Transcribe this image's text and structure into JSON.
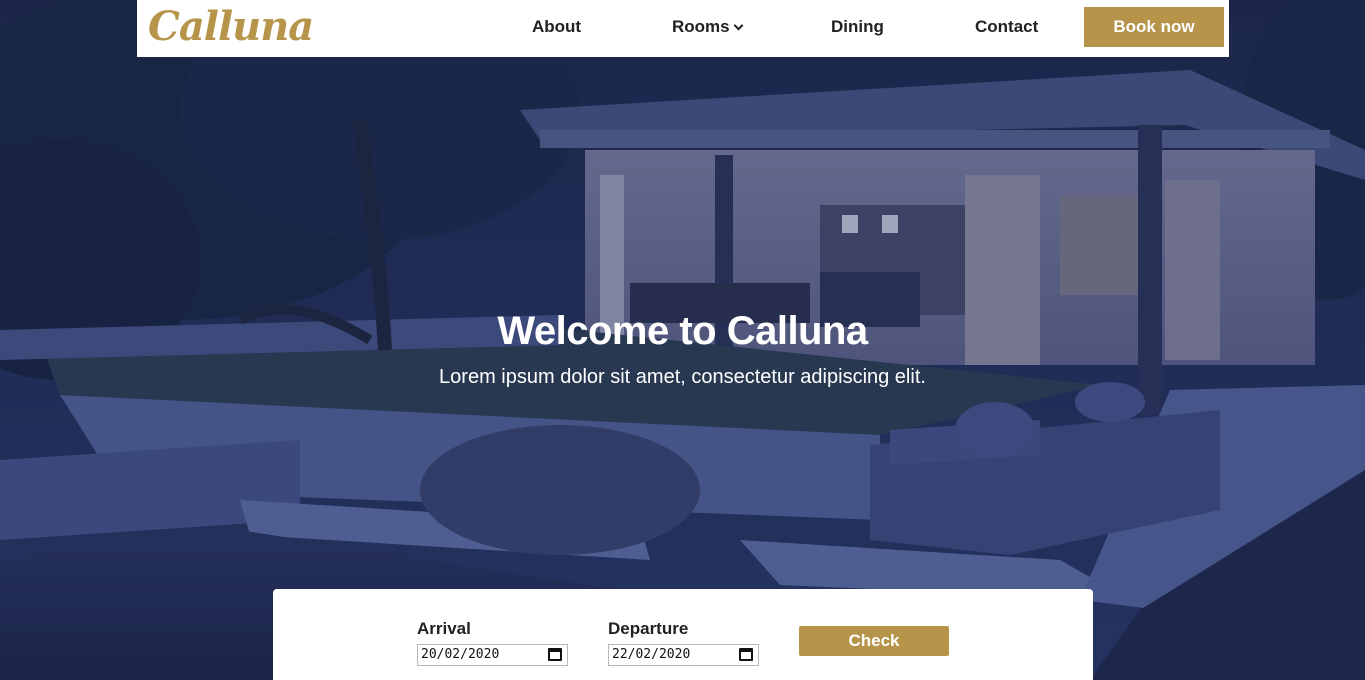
{
  "brand": {
    "logo_text": "Calluna",
    "accent_color": "#b6954b"
  },
  "nav": {
    "links": [
      {
        "label": "About"
      },
      {
        "label": "Rooms",
        "has_dropdown": true,
        "icon": "chevron-down-icon"
      },
      {
        "label": "Dining"
      },
      {
        "label": "Contact"
      }
    ],
    "book_label": "Book now"
  },
  "hero": {
    "title": "Welcome to Calluna",
    "subtitle": "Lorem ipsum dolor sit amet, consectetur adipiscing elit.",
    "overlay_color": "#1c2a5a"
  },
  "booking": {
    "arrival_label": "Arrival",
    "arrival_value": "20/02/2020",
    "departure_label": "Departure",
    "departure_value": "22/02/2020",
    "check_label": "Check",
    "date_icon": "calendar-icon"
  }
}
